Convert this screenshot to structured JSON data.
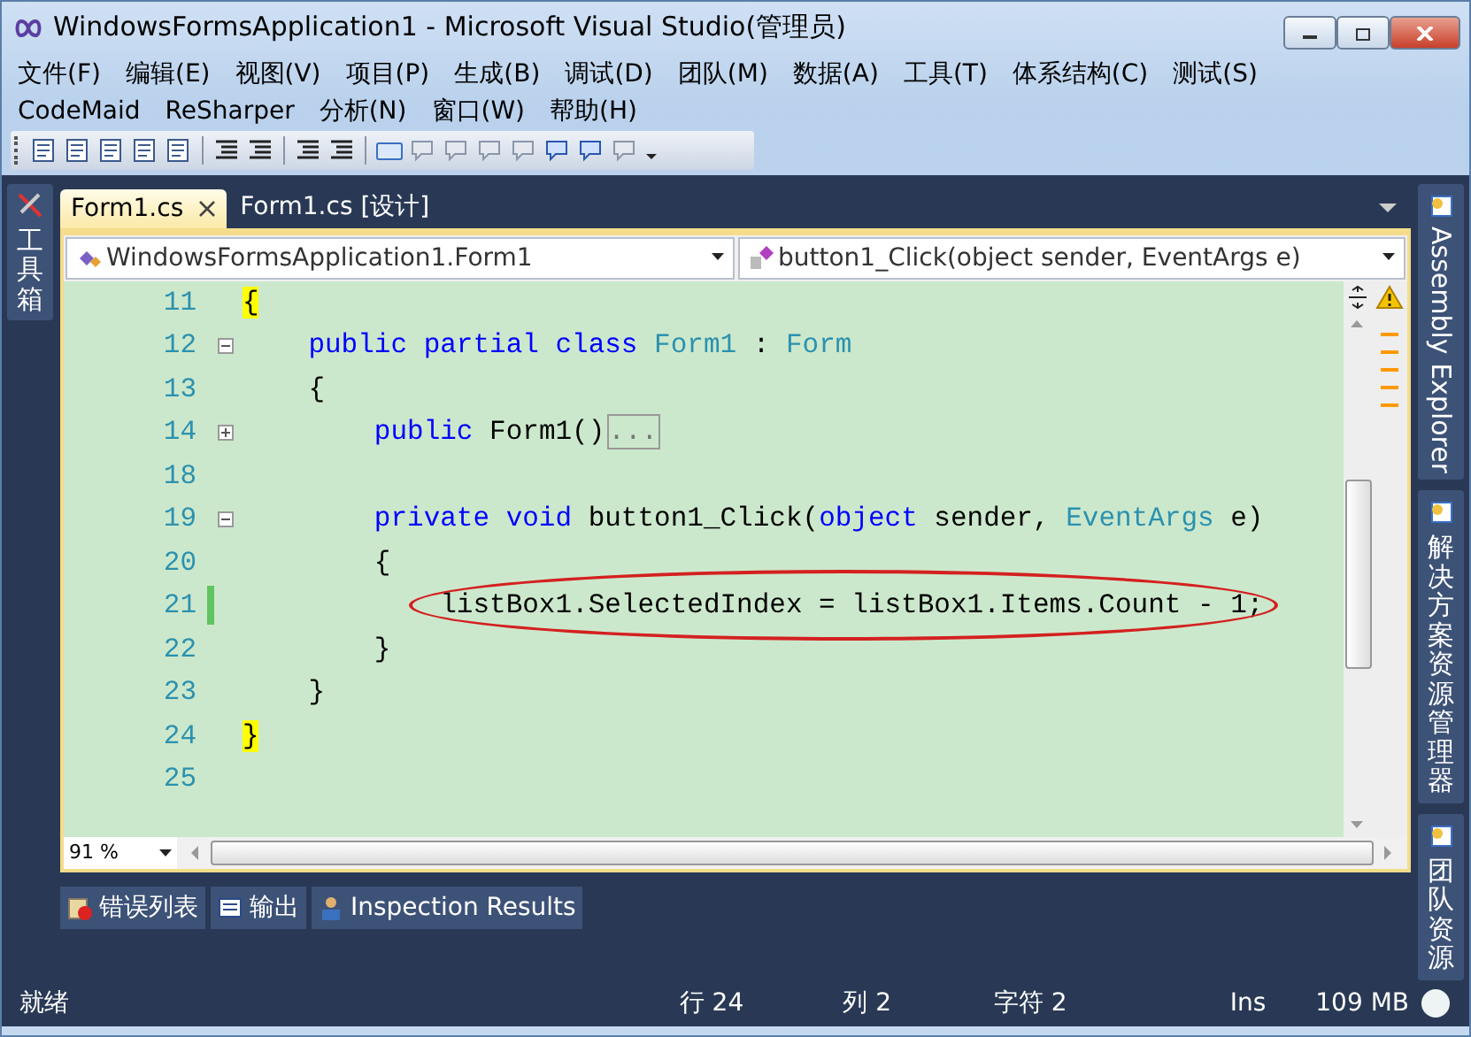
{
  "window": {
    "title": "WindowsFormsApplication1 - Microsoft Visual Studio(管理员)"
  },
  "menu_rows": [
    [
      "文件(F)",
      "编辑(E)",
      "视图(V)",
      "项目(P)",
      "生成(B)",
      "调试(D)",
      "团队(M)",
      "数据(A)",
      "工具(T)",
      "体系结构(C)",
      "测试(S)"
    ],
    [
      "CodeMaid",
      "ReSharper",
      "分析(N)",
      "窗口(W)",
      "帮助(H)"
    ]
  ],
  "left_panels": [
    {
      "label": "工具箱"
    }
  ],
  "tabs": [
    {
      "label": "Form1.cs",
      "selected": true
    },
    {
      "label": "Form1.cs [设计]",
      "selected": false
    }
  ],
  "navigation": {
    "type_dropdown": "WindowsFormsApplication1.Form1",
    "member_dropdown": "button1_Click(object sender, EventArgs e)"
  },
  "code_lines": [
    {
      "number": "11",
      "tokens": [
        {
          "text": "{",
          "kind": "brace_match"
        }
      ]
    },
    {
      "number": "12",
      "fold_collapsed": false,
      "tokens": [
        {
          "text": "    public partial class",
          "kind": "keyword"
        },
        {
          "text": " Form1",
          "kind": "type"
        },
        {
          "text": " : ",
          "kind": "plain"
        },
        {
          "text": "Form",
          "kind": "type"
        }
      ]
    },
    {
      "number": "13",
      "tokens": [
        {
          "text": "    {",
          "kind": "plain"
        }
      ]
    },
    {
      "number": "14",
      "fold_collapsed": true,
      "tokens": [
        {
          "text": "        public",
          "kind": "keyword"
        },
        {
          "text": " Form1()",
          "kind": "plain"
        },
        {
          "text": "...",
          "kind": "collapsed"
        }
      ]
    },
    {
      "number": "18"
    },
    {
      "number": "19",
      "fold_collapsed": false,
      "tokens": [
        {
          "text": "        private void",
          "kind": "keyword"
        },
        {
          "text": " button1_Click(",
          "kind": "plain"
        },
        {
          "text": "object",
          "kind": "keyword"
        },
        {
          "text": " sender, ",
          "kind": "plain"
        },
        {
          "text": "EventArgs",
          "kind": "type"
        },
        {
          "text": " e)",
          "kind": "plain"
        }
      ]
    },
    {
      "number": "20",
      "tokens": [
        {
          "text": "        {",
          "kind": "plain"
        }
      ]
    },
    {
      "number": "21",
      "changed": true,
      "circled": true,
      "tokens": [
        {
          "text": "            listBox1.SelectedIndex = listBox1.Items.Count - 1;",
          "kind": "plain"
        }
      ]
    },
    {
      "number": "22",
      "tokens": [
        {
          "text": "        }",
          "kind": "plain"
        }
      ]
    },
    {
      "number": "23",
      "tokens": [
        {
          "text": "    }",
          "kind": "plain"
        }
      ]
    },
    {
      "number": "24",
      "tokens": [
        {
          "text": "}",
          "kind": "brace_match"
        }
      ]
    },
    {
      "number": "25"
    }
  ],
  "zoom": "91 %",
  "right_panels": [
    {
      "label": "Assembly Explorer",
      "kind": "latin"
    },
    {
      "label": "解决方案资源管理器",
      "kind": "cjk"
    },
    {
      "label": "团队资源",
      "kind": "cjk"
    }
  ],
  "bottom_tabs": [
    {
      "label": "错误列表"
    },
    {
      "label": "输出"
    },
    {
      "label": "Inspection Results"
    }
  ],
  "status_bar": {
    "message": "就绪",
    "line": "行 24",
    "column": "列 2",
    "char": "字符 2",
    "mode": "Ins",
    "memory": "109 MB"
  }
}
